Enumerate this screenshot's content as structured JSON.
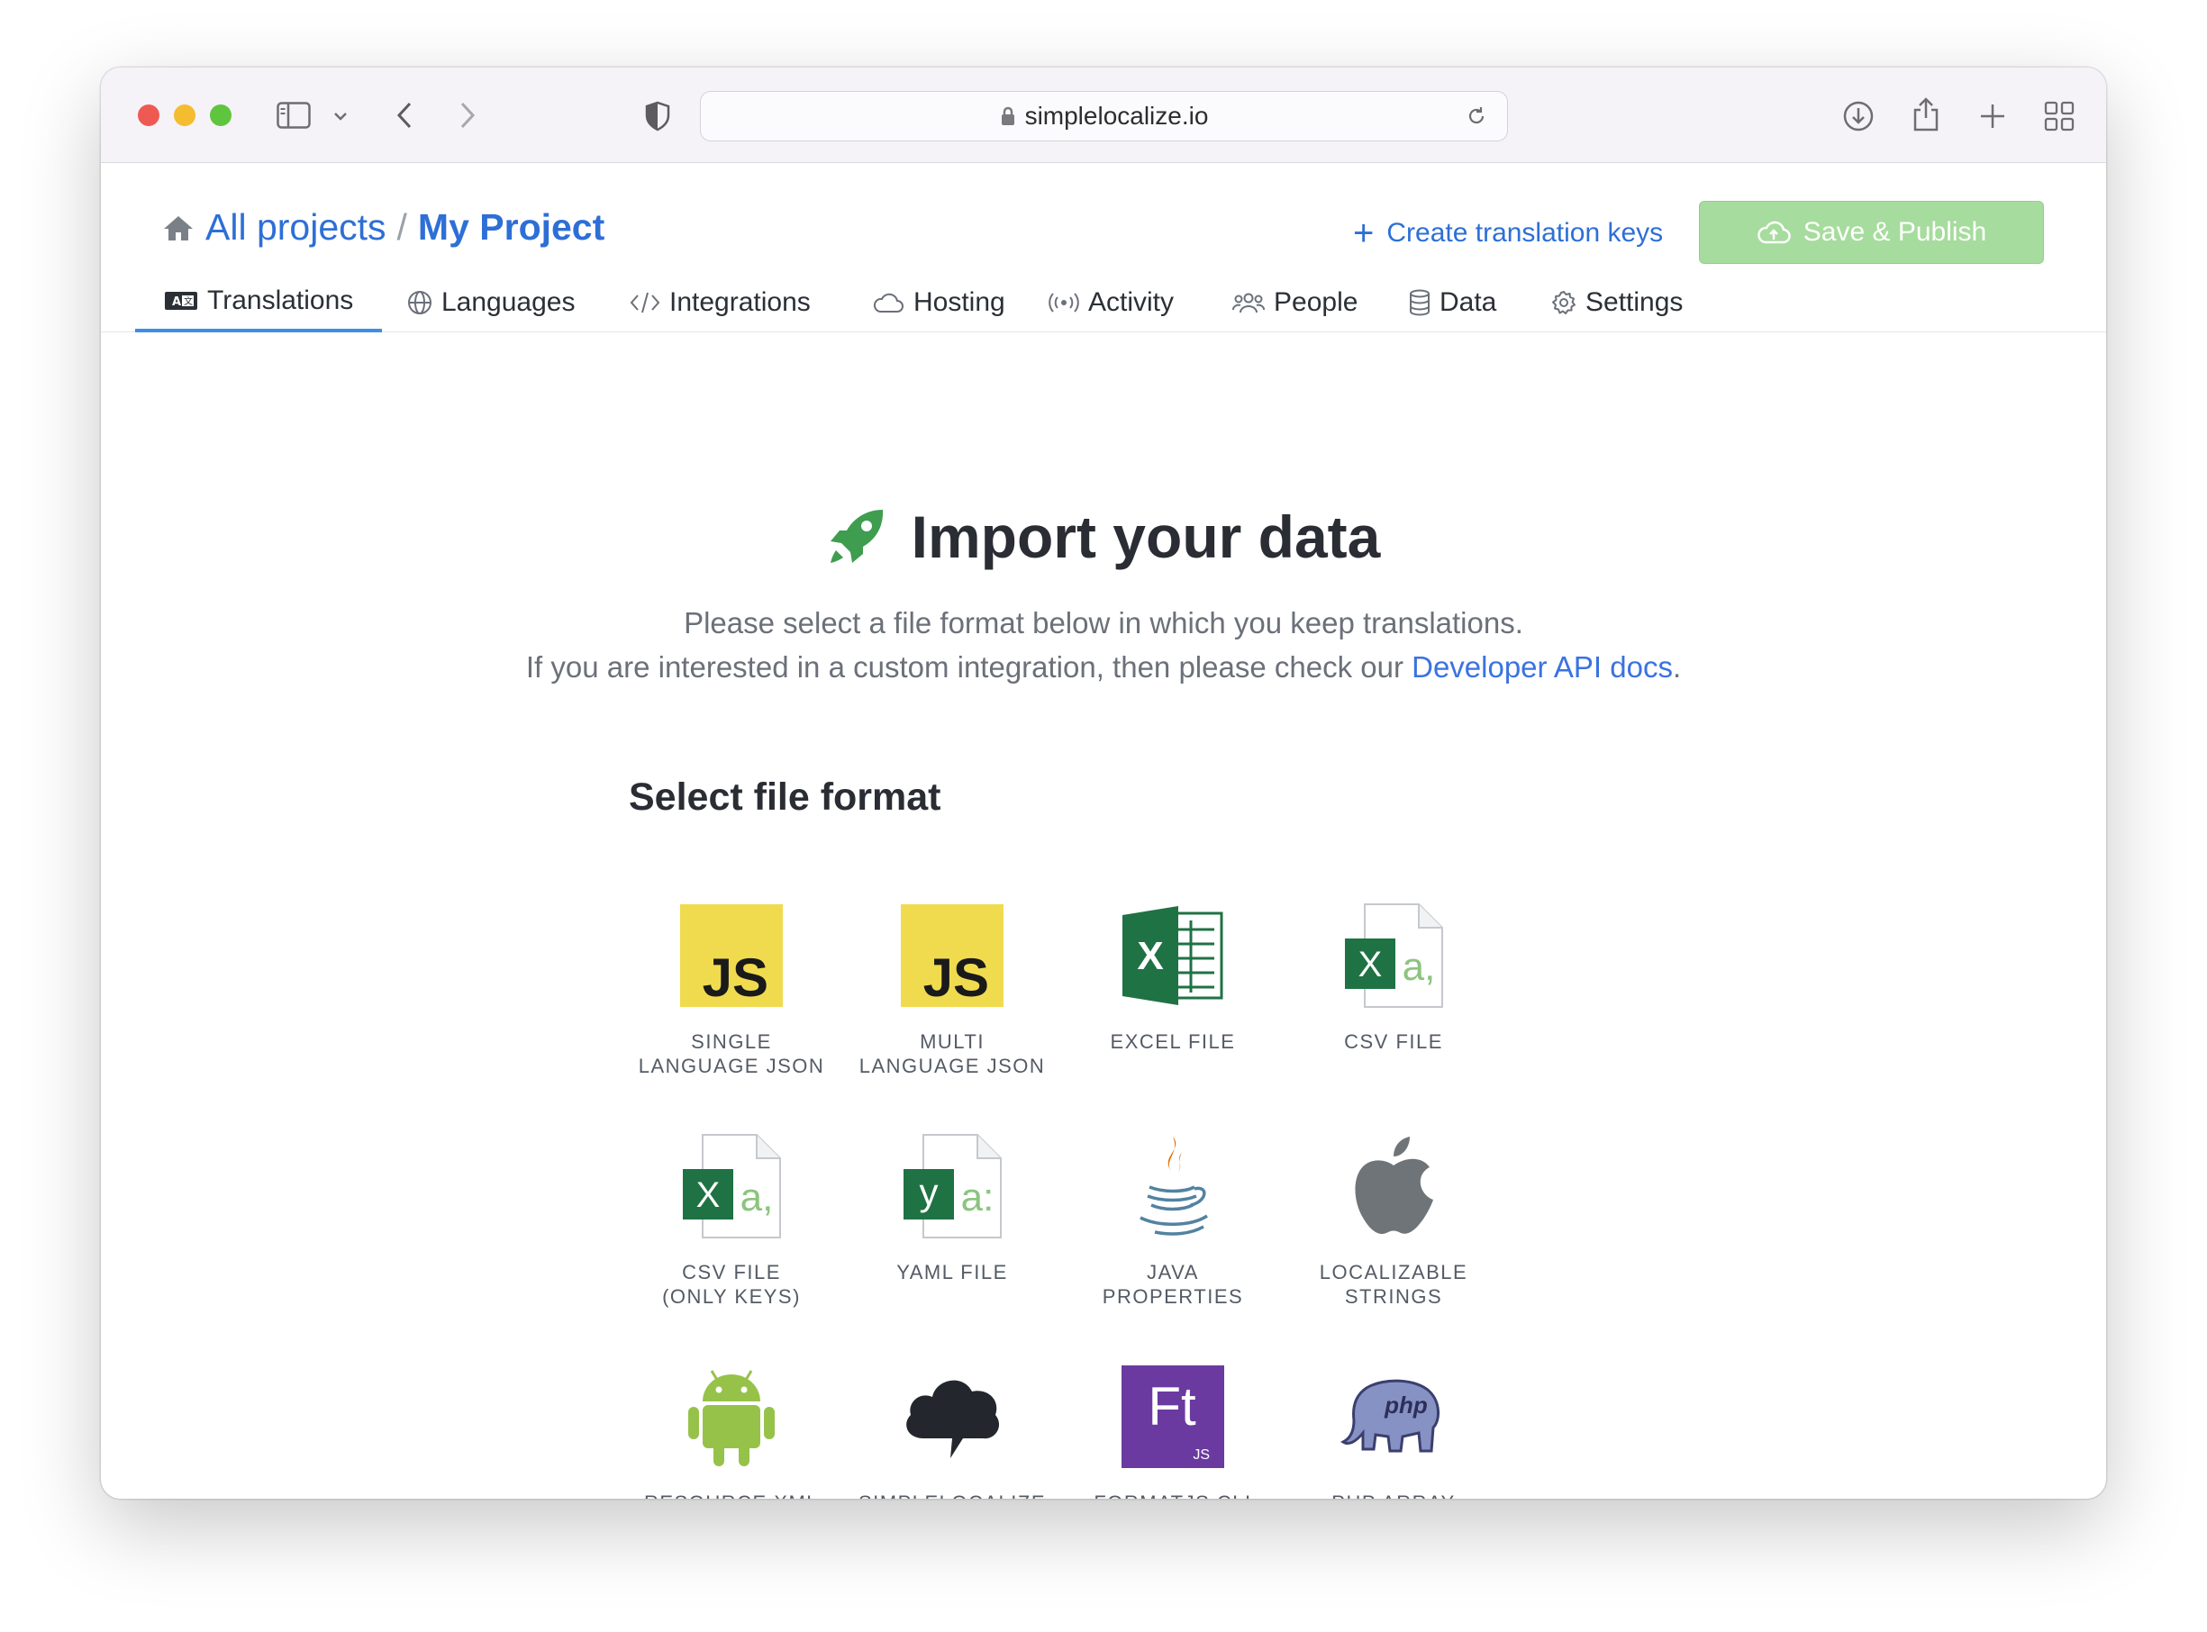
{
  "browser": {
    "url": "simplelocalize.io"
  },
  "header": {
    "breadcrumb_all": "All projects",
    "breadcrumb_sep": "/",
    "breadcrumb_current": "My Project",
    "create_keys_label": "Create translation keys",
    "publish_label": "Save & Publish"
  },
  "tabs": [
    {
      "label": "Translations",
      "icon": "translate-icon",
      "active": true
    },
    {
      "label": "Languages",
      "icon": "globe-icon"
    },
    {
      "label": "Integrations",
      "icon": "code-icon"
    },
    {
      "label": "Hosting",
      "icon": "cloud-icon"
    },
    {
      "label": "Activity",
      "icon": "broadcast-icon"
    },
    {
      "label": "People",
      "icon": "people-icon"
    },
    {
      "label": "Data",
      "icon": "database-icon"
    },
    {
      "label": "Settings",
      "icon": "gear-icon"
    }
  ],
  "main": {
    "title": "Import your data",
    "subtitle_line1": "Please select a file format below in which you keep translations.",
    "subtitle_line2_prefix": "If you are interested in a custom integration, then please check our ",
    "subtitle_link": "Developer API docs",
    "subtitle_line2_suffix": ".",
    "section_title": "Select file format"
  },
  "formats": [
    {
      "label": "SINGLE\nLANGUAGE JSON",
      "icon": "js-icon"
    },
    {
      "label": "MULTI\nLANGUAGE JSON",
      "icon": "js-icon"
    },
    {
      "label": "EXCEL FILE",
      "icon": "excel-icon"
    },
    {
      "label": "CSV FILE",
      "icon": "csv-file-icon"
    },
    {
      "label": "CSV FILE\n(ONLY KEYS)",
      "icon": "csv-file-icon"
    },
    {
      "label": "YAML FILE",
      "icon": "yaml-file-icon"
    },
    {
      "label": "JAVA\nPROPERTIES",
      "icon": "java-icon"
    },
    {
      "label": "LOCALIZABLE\nSTRINGS",
      "icon": "apple-icon"
    },
    {
      "label": "RESOURCE XML",
      "icon": "android-icon"
    },
    {
      "label": "SIMPLELOCALIZE\nJSON",
      "icon": "simplelocalize-cloud-icon"
    },
    {
      "label": "FORMATJS CLI",
      "icon": "formatjs-icon"
    },
    {
      "label": "PHP ARRAY",
      "icon": "php-icon"
    }
  ],
  "colors": {
    "link_blue": "#2d6fd6",
    "publish_green": "#a6dc9d",
    "rocket_green": "#3f9d4f",
    "excel_green": "#1f7244",
    "js_yellow": "#f0db4f",
    "formatjs_purple": "#6b3aa0"
  }
}
